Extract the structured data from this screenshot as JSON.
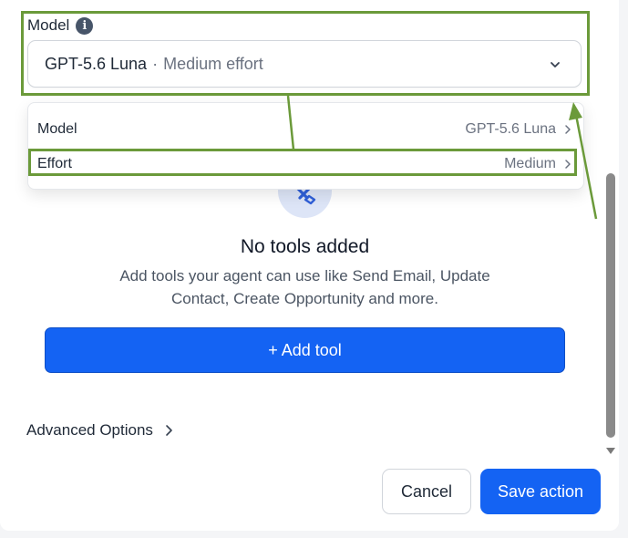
{
  "model_field": {
    "label": "Model",
    "selected_model": "GPT-5.6 Luna",
    "separator": "·",
    "selected_effort": "Medium effort"
  },
  "dropdown": {
    "rows": [
      {
        "label": "Model",
        "value": "GPT-5.6 Luna"
      },
      {
        "label": "Effort",
        "value": "Medium"
      }
    ]
  },
  "empty_state": {
    "title": "No tools added",
    "description": "Add tools your agent can use like Send Email, Update Contact, Create Opportunity and more."
  },
  "add_tool": {
    "plus": "+",
    "label": "Add tool"
  },
  "advanced_options": {
    "label": "Advanced Options"
  },
  "footer": {
    "cancel_label": "Cancel",
    "save_label": "Save action"
  },
  "colors": {
    "primary": "#1463f3",
    "annotation": "#6b9a3a",
    "tool_icon_bg": "#dde5f7",
    "tool_icon": "#2f5fd8"
  },
  "icons": {
    "info": "info-icon",
    "select_chevron": "chevron-down-icon",
    "row_chevron": "chevron-right-icon",
    "tools": "tools-icon",
    "advanced_chevron": "chevron-right-icon"
  }
}
